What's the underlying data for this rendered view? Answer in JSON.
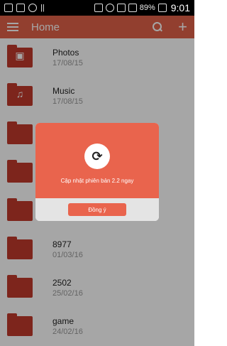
{
  "statusbar": {
    "battery": "89%",
    "time": "9:01"
  },
  "appbar": {
    "title": "Home"
  },
  "folders": [
    {
      "name": "Photos",
      "date": "17/08/15",
      "icon": "image-icon"
    },
    {
      "name": "Music",
      "date": "17/08/15",
      "icon": "music-icon"
    },
    {
      "name": "",
      "date": "",
      "icon": ""
    },
    {
      "name": "",
      "date": "",
      "icon": ""
    },
    {
      "name": "",
      "date": "",
      "icon": ""
    },
    {
      "name": "8977",
      "date": "01/03/16",
      "icon": ""
    },
    {
      "name": "2502",
      "date": "25/02/16",
      "icon": ""
    },
    {
      "name": "game",
      "date": "24/02/16",
      "icon": ""
    }
  ],
  "dialog": {
    "message": "Cập nhật phiên bản 2.2 ngay",
    "ok_label": "Đồng ý"
  },
  "colors": {
    "accent": "#e06249",
    "folder": "#c0392b"
  }
}
